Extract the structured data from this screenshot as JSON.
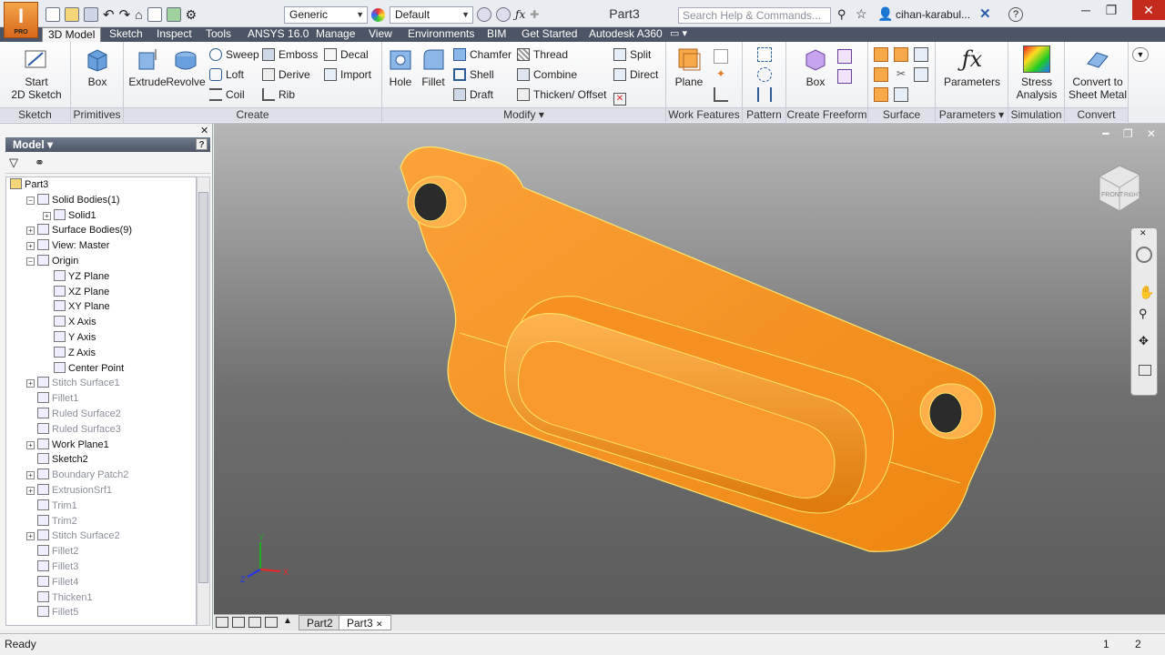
{
  "app": {
    "logo": "I",
    "edition": "PRO"
  },
  "qat": {
    "material": "Generic",
    "appearance": "Default"
  },
  "title": "Part3",
  "search": {
    "placeholder": "Search Help & Commands..."
  },
  "user": "cihan-karabul...",
  "tabs": [
    "3D Model",
    "Sketch",
    "Inspect",
    "Tools",
    "ANSYS 16.0",
    "Manage",
    "View",
    "Environments",
    "BIM",
    "Get Started",
    "Autodesk A360"
  ],
  "ribbon": {
    "sketch": {
      "title": "Sketch",
      "start": "Start",
      "sketch2d": "2D Sketch"
    },
    "primitives": {
      "title": "Primitives",
      "box": "Box"
    },
    "create": {
      "title": "Create",
      "extrude": "Extrude",
      "revolve": "Revolve",
      "sweep": "Sweep",
      "loft": "Loft",
      "coil": "Coil",
      "emboss": "Emboss",
      "derive": "Derive",
      "rib": "Rib",
      "decal": "Decal",
      "import": "Import"
    },
    "modify": {
      "title": "Modify",
      "hole": "Hole",
      "fillet": "Fillet",
      "chamfer": "Chamfer",
      "shell": "Shell",
      "draft": "Draft",
      "thread": "Thread",
      "combine": "Combine",
      "thicken": "Thicken/ Offset",
      "split": "Split",
      "direct": "Direct"
    },
    "workfeatures": {
      "title": "Work Features",
      "plane": "Plane"
    },
    "pattern": {
      "title": "Pattern"
    },
    "freeform": {
      "title": "Create Freeform",
      "box": "Box"
    },
    "surface": {
      "title": "Surface"
    },
    "parameters": {
      "title": "Parameters",
      "label": "Parameters"
    },
    "simulation": {
      "title": "Simulation",
      "stress1": "Stress",
      "stress2": "Analysis"
    },
    "convert": {
      "title": "Convert",
      "c1": "Convert to",
      "c2": "Sheet Metal"
    }
  },
  "browser": {
    "header": "Model",
    "help": "?",
    "tree": [
      {
        "label": "Part3",
        "indent": 0,
        "exp": "",
        "dim": false
      },
      {
        "label": "Solid Bodies(1)",
        "indent": 1,
        "exp": "-",
        "dim": false
      },
      {
        "label": "Solid1",
        "indent": 2,
        "exp": "+",
        "dim": false
      },
      {
        "label": "Surface Bodies(9)",
        "indent": 1,
        "exp": "+",
        "dim": false
      },
      {
        "label": "View: Master",
        "indent": 1,
        "exp": "+",
        "dim": false
      },
      {
        "label": "Origin",
        "indent": 1,
        "exp": "-",
        "dim": false
      },
      {
        "label": "YZ Plane",
        "indent": 2,
        "exp": "",
        "dim": false
      },
      {
        "label": "XZ Plane",
        "indent": 2,
        "exp": "",
        "dim": false
      },
      {
        "label": "XY Plane",
        "indent": 2,
        "exp": "",
        "dim": false
      },
      {
        "label": "X Axis",
        "indent": 2,
        "exp": "",
        "dim": false
      },
      {
        "label": "Y Axis",
        "indent": 2,
        "exp": "",
        "dim": false
      },
      {
        "label": "Z Axis",
        "indent": 2,
        "exp": "",
        "dim": false
      },
      {
        "label": "Center Point",
        "indent": 2,
        "exp": "",
        "dim": false
      },
      {
        "label": "Stitch Surface1",
        "indent": 1,
        "exp": "+",
        "dim": true
      },
      {
        "label": "Fillet1",
        "indent": 1,
        "exp": "",
        "dim": true
      },
      {
        "label": "Ruled Surface2",
        "indent": 1,
        "exp": "",
        "dim": true
      },
      {
        "label": "Ruled Surface3",
        "indent": 1,
        "exp": "",
        "dim": true
      },
      {
        "label": "Work Plane1",
        "indent": 1,
        "exp": "+",
        "dim": false
      },
      {
        "label": "Sketch2",
        "indent": 1,
        "exp": "",
        "dim": false
      },
      {
        "label": "Boundary Patch2",
        "indent": 1,
        "exp": "+",
        "dim": true
      },
      {
        "label": "ExtrusionSrf1",
        "indent": 1,
        "exp": "+",
        "dim": true
      },
      {
        "label": "Trim1",
        "indent": 1,
        "exp": "",
        "dim": true
      },
      {
        "label": "Trim2",
        "indent": 1,
        "exp": "",
        "dim": true
      },
      {
        "label": "Stitch Surface2",
        "indent": 1,
        "exp": "+",
        "dim": true
      },
      {
        "label": "Fillet2",
        "indent": 1,
        "exp": "",
        "dim": true
      },
      {
        "label": "Fillet3",
        "indent": 1,
        "exp": "",
        "dim": true
      },
      {
        "label": "Fillet4",
        "indent": 1,
        "exp": "",
        "dim": true
      },
      {
        "label": "Thicken1",
        "indent": 1,
        "exp": "",
        "dim": true
      },
      {
        "label": "Fillet5",
        "indent": 1,
        "exp": "",
        "dim": true
      }
    ]
  },
  "viewcube": {
    "front": "FRONT",
    "right": "RIGHT"
  },
  "triad": {
    "x": "X",
    "y": "Y",
    "z": "Z"
  },
  "doctabs": [
    "Part2",
    "Part3"
  ],
  "status": {
    "text": "Ready",
    "n1": "1",
    "n2": "2"
  },
  "colors": {
    "part": "#f7941d",
    "edge": "#ffe66b"
  }
}
